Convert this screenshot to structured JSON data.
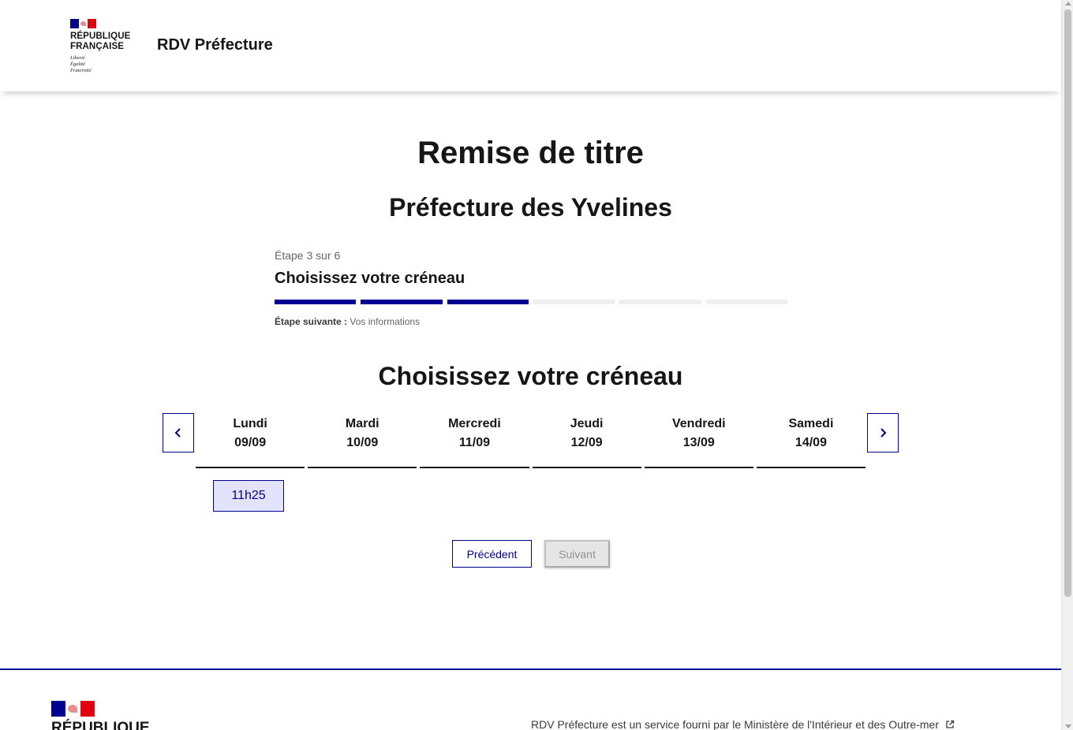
{
  "header": {
    "logo_line1": "RÉPUBLIQUE",
    "logo_line2": "FRANÇAISE",
    "motto_line1": "Liberté",
    "motto_line2": "Égalité",
    "motto_line3": "Fraternité",
    "service_title": "RDV Préfecture"
  },
  "main": {
    "title": "Remise de titre",
    "subtitle": "Préfecture des Yvelines"
  },
  "stepper": {
    "state": "Étape 3 sur 6",
    "current_step": 3,
    "total_steps": 6,
    "title": "Choisissez votre créneau",
    "next_label": "Étape suivante :",
    "next_value": "Vos informations"
  },
  "slots": {
    "title": "Choisissez votre créneau",
    "days": [
      {
        "name": "Lundi",
        "date": "09/09"
      },
      {
        "name": "Mardi",
        "date": "10/09"
      },
      {
        "name": "Mercredi",
        "date": "11/09"
      },
      {
        "name": "Jeudi",
        "date": "12/09"
      },
      {
        "name": "Vendredi",
        "date": "13/09"
      },
      {
        "name": "Samedi",
        "date": "14/09"
      }
    ],
    "available_slot": "11h25"
  },
  "actions": {
    "previous": "Précédent",
    "next": "Suivant"
  },
  "footer": {
    "logo_line1": "RÉPUBLIQUE",
    "description": "RDV Préfecture est un service fourni par le Ministère de l'Intérieur et des Outre-mer"
  },
  "colors": {
    "primary": "#000091",
    "slot_bg": "#e3e3fd",
    "disabled_bg": "#e5e5e5",
    "marianne_red": "#e1000f"
  }
}
